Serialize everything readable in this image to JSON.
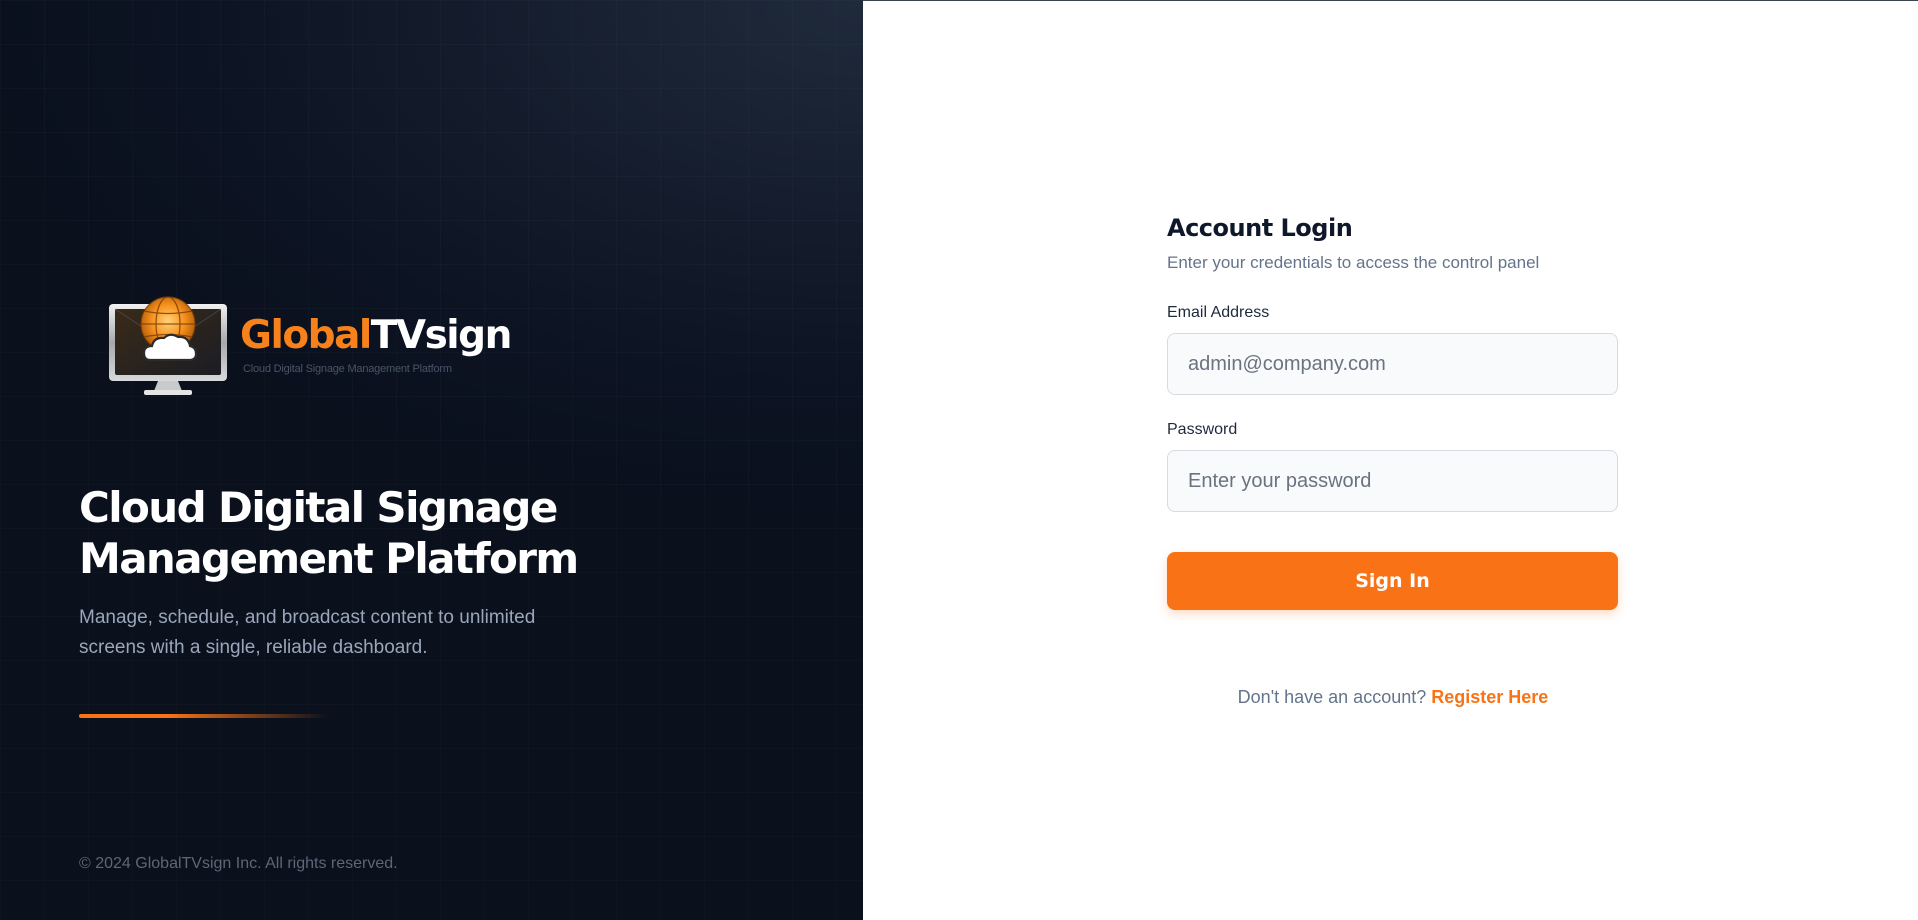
{
  "brand": {
    "logo": {
      "wordmark_orange": "Global",
      "wordmark_white": "TVsign",
      "tagline": "Cloud Digital Signage Management Platform",
      "icon": "cloud-monitor-globe-icon"
    },
    "headline_line1": "Cloud Digital Signage",
    "headline_line2": "Management Platform",
    "description": "Manage, schedule, and broadcast content to unlimited screens with a single, reliable dashboard.",
    "copyright": "© 2024 GlobalTVsign Inc. All rights reserved.",
    "colors": {
      "accent": "#f97316",
      "panel_bg": "#0f1728"
    }
  },
  "login": {
    "title": "Account Login",
    "subtitle": "Enter your credentials to access the control panel",
    "email": {
      "label": "Email Address",
      "placeholder": "admin@company.com",
      "value": ""
    },
    "password": {
      "label": "Password",
      "placeholder": "Enter your password",
      "value": ""
    },
    "submit_label": "Sign In",
    "register_prompt": "Don't have an account?",
    "register_link": "Register Here"
  }
}
